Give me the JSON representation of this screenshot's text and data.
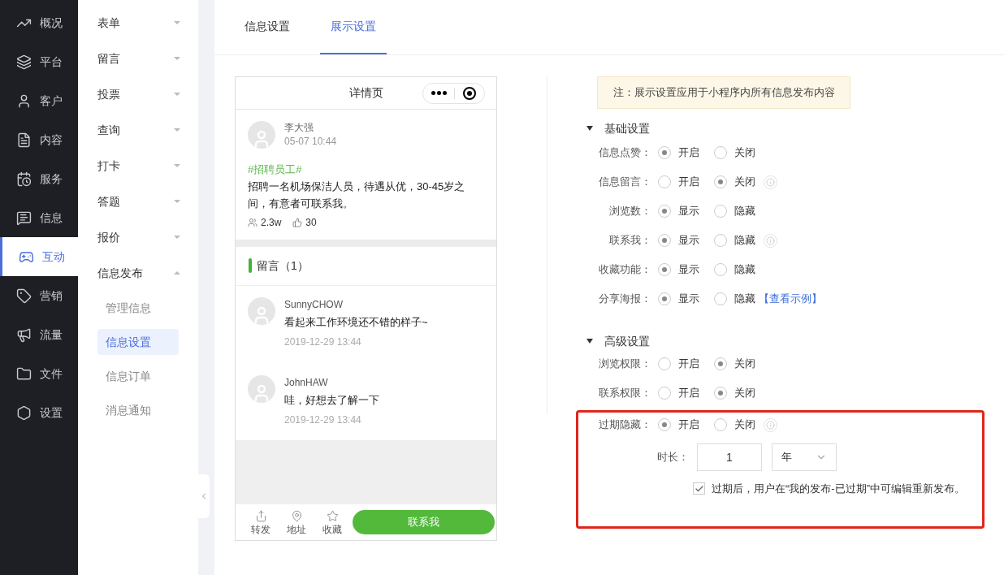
{
  "nav": [
    {
      "label": "概况",
      "selected": false
    },
    {
      "label": "平台",
      "selected": false
    },
    {
      "label": "客户",
      "selected": false
    },
    {
      "label": "内容",
      "selected": false
    },
    {
      "label": "服务",
      "selected": false
    },
    {
      "label": "信息",
      "selected": false
    },
    {
      "label": "互动",
      "selected": true
    },
    {
      "label": "营销",
      "selected": false
    },
    {
      "label": "流量",
      "selected": false
    },
    {
      "label": "文件",
      "selected": false
    },
    {
      "label": "设置",
      "selected": false
    }
  ],
  "submenu": [
    {
      "label": "表单",
      "expanded": false
    },
    {
      "label": "留言",
      "expanded": false
    },
    {
      "label": "投票",
      "expanded": false
    },
    {
      "label": "查询",
      "expanded": false
    },
    {
      "label": "打卡",
      "expanded": false
    },
    {
      "label": "答题",
      "expanded": false
    },
    {
      "label": "报价",
      "expanded": false
    },
    {
      "label": "信息发布",
      "expanded": true,
      "children": [
        {
          "label": "管理信息",
          "selected": false
        },
        {
          "label": "信息设置",
          "selected": true
        },
        {
          "label": "信息订单",
          "selected": false
        },
        {
          "label": "消息通知",
          "selected": false
        }
      ]
    }
  ],
  "tabs": [
    {
      "label": "信息设置",
      "selected": false
    },
    {
      "label": "展示设置",
      "selected": true
    }
  ],
  "preview": {
    "title": "详情页",
    "post": {
      "author": "李大强",
      "time": "05-07 10:44",
      "tag": "#招聘员工#",
      "text": "招聘一名机场保洁人员，待遇从优，30-45岁之间，有意者可联系我。",
      "views": "2.3w",
      "likes": "30"
    },
    "comments_heading": "留言（1）",
    "comments": [
      {
        "name": "SunnyCHOW",
        "text": "看起来工作环境还不错的样子~",
        "time": "2019-12-29 13:44"
      },
      {
        "name": "JohnHAW",
        "text": "哇，好想去了解一下",
        "time": "2019-12-29 13:44"
      }
    ],
    "actions": [
      {
        "label": "转发"
      },
      {
        "label": "地址"
      },
      {
        "label": "收藏"
      }
    ],
    "contact_button": "联系我"
  },
  "notice": "注：展示设置应用于小程序内所有信息发布内容",
  "sections": [
    {
      "title": "基础设置",
      "expanded": true,
      "rows": [
        {
          "label": "信息点赞：",
          "info": false,
          "options": [
            {
              "label": "开启",
              "selected": true
            },
            {
              "label": "关闭",
              "selected": false
            }
          ]
        },
        {
          "label": "信息留言：",
          "info": true,
          "options": [
            {
              "label": "开启",
              "selected": false
            },
            {
              "label": "关闭",
              "selected": true
            }
          ]
        },
        {
          "label": "浏览数：",
          "info": false,
          "options": [
            {
              "label": "显示",
              "selected": true
            },
            {
              "label": "隐藏",
              "selected": false
            }
          ]
        },
        {
          "label": "联系我：",
          "info": true,
          "options": [
            {
              "label": "显示",
              "selected": true
            },
            {
              "label": "隐藏",
              "selected": false
            }
          ]
        },
        {
          "label": "收藏功能：",
          "info": false,
          "options": [
            {
              "label": "显示",
              "selected": true
            },
            {
              "label": "隐藏",
              "selected": false
            }
          ]
        },
        {
          "label": "分享海报：",
          "info": false,
          "link": "【查看示例】",
          "options": [
            {
              "label": "显示",
              "selected": true
            },
            {
              "label": "隐藏",
              "selected": false
            }
          ]
        }
      ]
    },
    {
      "title": "高级设置",
      "expanded": true,
      "rows": [
        {
          "label": "浏览权限：",
          "info": false,
          "options": [
            {
              "label": "开启",
              "selected": false
            },
            {
              "label": "关闭",
              "selected": true
            }
          ]
        },
        {
          "label": "联系权限：",
          "info": false,
          "options": [
            {
              "label": "开启",
              "selected": false
            },
            {
              "label": "关闭",
              "selected": true
            }
          ]
        }
      ]
    }
  ],
  "expire": {
    "highlighted": true,
    "label": "过期隐藏：",
    "info": true,
    "options": [
      {
        "label": "开启",
        "selected": true
      },
      {
        "label": "关闭",
        "selected": false
      }
    ],
    "duration_label": "时长：",
    "duration_value": "1",
    "unit": "年",
    "checkbox": {
      "label": "过期后，用户在“我的发布-已过期”中可编辑重新发布。",
      "checked": true
    }
  }
}
